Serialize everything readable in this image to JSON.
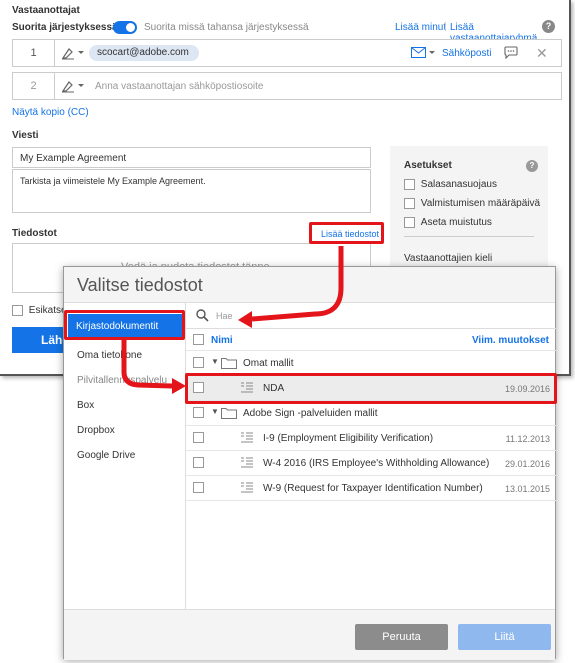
{
  "recipients": {
    "title": "Vastaanottajat",
    "order_label": "Suorita järjestyksessä",
    "any_order_label": "Suorita missä tahansa järjestyksessä",
    "add_me": "Lisää minut",
    "add_group": "Lisää vastaanottajaryhmä",
    "help_icon": "?",
    "rows": [
      {
        "num": "1",
        "email": "scocart@adobe.com",
        "method": "Sähköposti"
      },
      {
        "num": "2",
        "placeholder": "Anna vastaanottajan sähköpostiosoite"
      }
    ],
    "cc_link": "Näytä kopio (CC)"
  },
  "message": {
    "title": "Viesti",
    "name": "My Example Agreement",
    "body": "Tarkista ja viimeistele My Example Agreement."
  },
  "files": {
    "title": "Tiedostot",
    "add_files": "Lisää tiedostot",
    "drop_text": "Vedä ja pudota tiedostot tänne"
  },
  "settings": {
    "title": "Asetukset",
    "options": [
      "Salasanasuojaus",
      "Valmistumisen määräpäivä",
      "Aseta muistutus"
    ],
    "lang_label": "Vastaanottajien kieli"
  },
  "bottom": {
    "preview_label": "Esikatselu",
    "send_label": "Lähe"
  },
  "dialog": {
    "title": "Valitse tiedostot",
    "search_placeholder": "Hae",
    "sidebar": {
      "active": "Kirjastodokumentit",
      "items": [
        "Oma tietokone"
      ],
      "cloud_heading": "Pilvitallennuspalvelu",
      "cloud_items": [
        "Box",
        "Dropbox",
        "Google Drive"
      ]
    },
    "columns": {
      "name": "Nimi",
      "modified": "Viim. muutokset"
    },
    "rows": [
      {
        "type": "folder",
        "name": "Omat mallit",
        "date": ""
      },
      {
        "type": "doc",
        "name": "NDA",
        "date": "19.09.2016"
      },
      {
        "type": "folder",
        "name": "Adobe Sign -palveluiden mallit",
        "date": ""
      },
      {
        "type": "doc",
        "name": "I-9 (Employment Eligibility Verification)",
        "date": "11.12.2013"
      },
      {
        "type": "doc",
        "name": "W-4 2016 (IRS Employee's Withholding Allowance)",
        "date": "29.01.2016"
      },
      {
        "type": "doc",
        "name": "W-9 (Request for Taxpayer Identification Number)",
        "date": "13.01.2015"
      }
    ],
    "cancel": "Peruuta",
    "attach": "Liitä"
  },
  "colors": {
    "accent": "#1473e6",
    "highlight": "#e3141a",
    "cancel_btn": "#8c8c8c",
    "attach_btn": "#8fb8ee"
  }
}
